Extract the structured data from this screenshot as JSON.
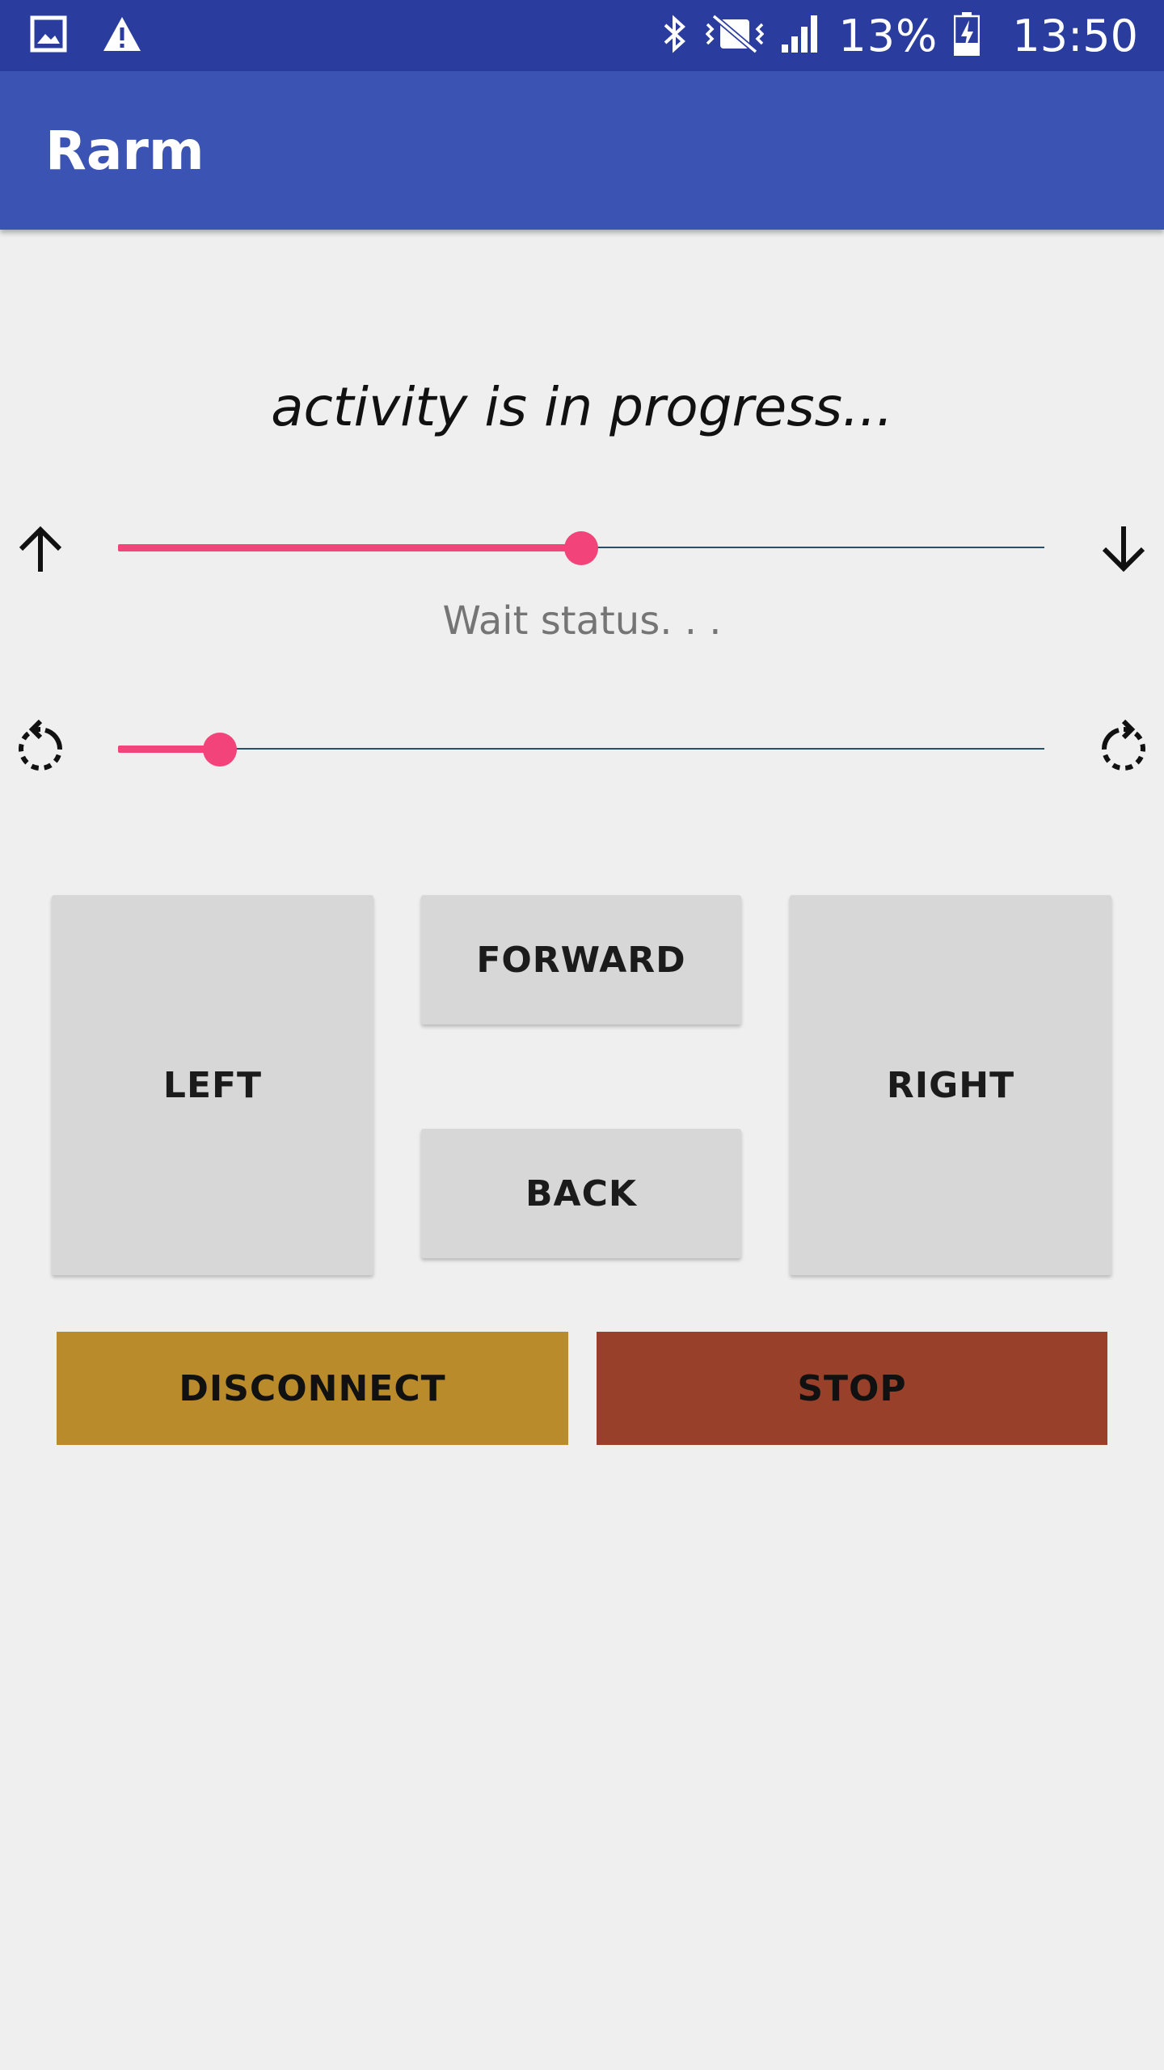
{
  "status_bar": {
    "battery_percent": "13%",
    "time": "13:50",
    "icons": [
      "image-icon",
      "warning-icon",
      "bluetooth-icon",
      "vibrate-icon",
      "signal-icon",
      "battery-charging-icon"
    ]
  },
  "app_bar": {
    "title": "Rarm"
  },
  "main": {
    "progress_text": "activity is in progress...",
    "wait_status": "Wait status. . .",
    "vertical_slider": {
      "value_fraction": 0.5,
      "left_icon": "arrow-up-icon",
      "right_icon": "arrow-down-icon"
    },
    "rotation_slider": {
      "value_fraction": 0.11,
      "left_icon": "rotate-left-icon",
      "right_icon": "rotate-right-icon"
    },
    "buttons": {
      "left": "LEFT",
      "forward": "FORWARD",
      "back": "BACK",
      "right": "RIGHT",
      "disconnect": "DISCONNECT",
      "stop": "STOP"
    }
  },
  "colors": {
    "status_bar": "#2a3c9e",
    "app_bar": "#3b53b3",
    "accent": "#f2437a",
    "disconnect": "#ba8b2a",
    "stop": "#99402a",
    "button_gray": "#d6d7d6"
  }
}
